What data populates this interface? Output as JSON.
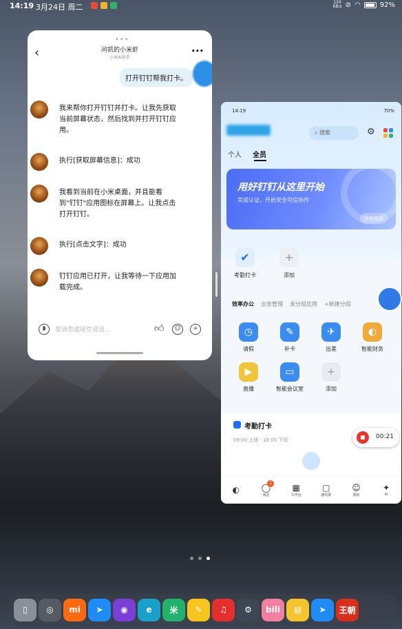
{
  "status_bar": {
    "time": "14:19",
    "date": "3月24日 周二",
    "network": "120\nKB/s",
    "battery": "92%"
  },
  "chat": {
    "title": "问凯的小米虾",
    "subtitle": "小米AI助手",
    "user_message": "打开钉钉帮我打卡。",
    "bot_messages": [
      "我来帮你打开钉钉并打卡。让我先获取当前屏幕状态，然后找到并打开钉钉应用。",
      "执行[获取屏幕信息]：成功",
      "我看到当前在小米桌面，并且能看到\"钉钉\"应用图标在屏幕上。让我点击打开钉钉。",
      "执行[点击文字]：成功",
      "钉钉应用已打开，让我等待一下应用加载完成。"
    ],
    "input_placeholder": "发消息或按住说话..."
  },
  "ding": {
    "status_time": "14:19",
    "status_battery": "70%",
    "search_placeholder": "搜索",
    "tabs": [
      "个人",
      "全员"
    ],
    "banner": {
      "title": "用好钉钉从这里开始",
      "subtitle": "完成认证，开启安全可信协作",
      "button": "开启全员"
    },
    "quick": [
      {
        "label": "考勤打卡",
        "icon": "check-shield-icon"
      },
      {
        "label": "添加",
        "icon": "plus-icon"
      }
    ],
    "app_tabs": [
      "效率办公",
      "业务管理",
      "未分组应用",
      "+新建分组"
    ],
    "apps": [
      {
        "label": "请假",
        "color": "#3b8cf0"
      },
      {
        "label": "补卡",
        "color": "#3b8cf0"
      },
      {
        "label": "出差",
        "color": "#3b8cf0"
      },
      {
        "label": "智能财务",
        "color": "#f0a93b"
      },
      {
        "label": "直播",
        "color": "#f0c53b"
      },
      {
        "label": "智能会议室",
        "color": "#3b8cf0"
      },
      {
        "label": "添加",
        "color": "#e8ecf2"
      }
    ],
    "attendance": {
      "title": "考勤打卡",
      "subtitle": "09:00 上班 · 18:00 下班"
    },
    "nav": [
      "",
      "消息",
      "工作台",
      "通讯录",
      "我的",
      "AI"
    ]
  },
  "recording": {
    "time": "00:21"
  },
  "dock_apps": [
    {
      "name": "phone-app",
      "label": "▯",
      "color": "#8a8f99"
    },
    {
      "name": "aperture-app",
      "label": "◎",
      "color": "#555a64"
    },
    {
      "name": "mi-store-app",
      "label": "mi",
      "color": "#ff6a10"
    },
    {
      "name": "dingtalk-app",
      "label": "➤",
      "color": "#1f8bf5"
    },
    {
      "name": "photo-app",
      "label": "◉",
      "color": "#7a3fd6"
    },
    {
      "name": "edge-app",
      "label": "e",
      "color": "#1aa1c9"
    },
    {
      "name": "mijia-app",
      "label": "米",
      "color": "#21b36b"
    },
    {
      "name": "notes-app",
      "label": "✎",
      "color": "#f7c51d"
    },
    {
      "name": "netease-music-app",
      "label": "♫",
      "color": "#e52e2e"
    },
    {
      "name": "settings-app",
      "label": "⚙",
      "color": "#3d4654"
    },
    {
      "name": "bilibili-app",
      "label": "bili",
      "color": "#f27fa0"
    },
    {
      "name": "files-app",
      "label": "▤",
      "color": "#f5c42b"
    },
    {
      "name": "dingtalk2-app",
      "label": "➤",
      "color": "#1f8bf5"
    },
    {
      "name": "wangchao-app",
      "label": "王朝",
      "color": "#d82e1e"
    }
  ]
}
